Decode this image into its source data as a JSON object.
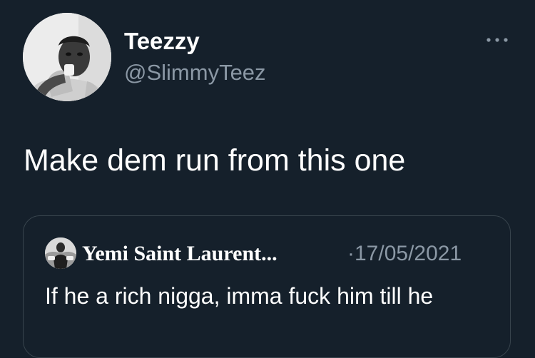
{
  "tweet": {
    "author": {
      "display_name": "Teezzy",
      "handle": "@SlimmyTeez",
      "avatar_icon": "profile-photo"
    },
    "more_icon": "more-horizontal-icon",
    "text": "Make dem run from this one"
  },
  "quoted_tweet": {
    "author_name": "Yemi Saint Laurent...",
    "separator": "·",
    "date": "17/05/2021",
    "date_display": "·17/05/2021",
    "text": "If he a rich nigga, imma fuck him till he"
  },
  "colors": {
    "background": "#15202b",
    "primary_text": "#ffffff",
    "secondary_text": "#8b98a5",
    "border": "#38444d"
  }
}
